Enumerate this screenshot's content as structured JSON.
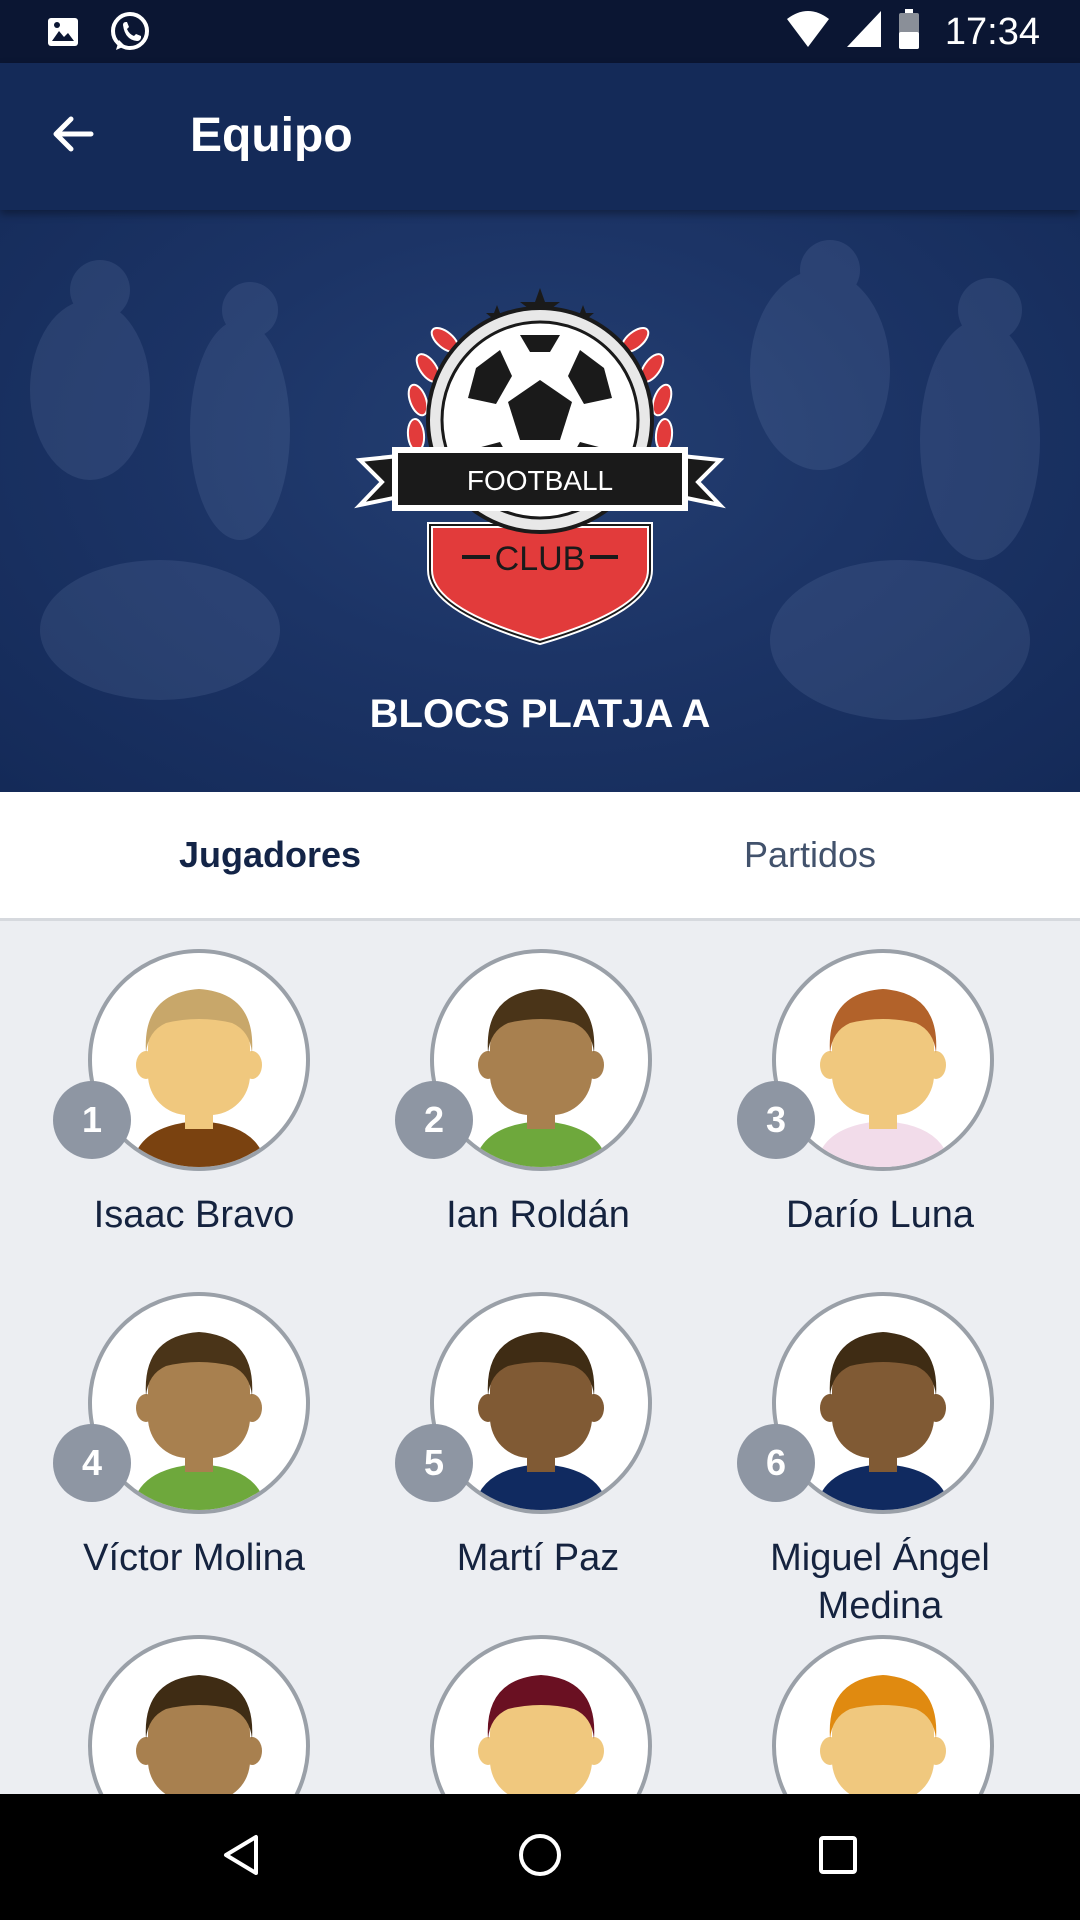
{
  "status_bar": {
    "time": "17:34",
    "left_icons": [
      "image-icon",
      "whatsapp-icon"
    ],
    "right_icons": [
      "wifi-icon",
      "signal-icon",
      "battery-icon"
    ]
  },
  "app_bar": {
    "title": "Equipo",
    "back_icon": "arrow-back-icon"
  },
  "hero": {
    "logo_text_top": "FOOTBALL",
    "logo_text_bottom": "CLUB",
    "team_name": "BLOCS PLATJA A"
  },
  "tabs": [
    {
      "label": "Jugadores",
      "active": true
    },
    {
      "label": "Partidos",
      "active": false
    }
  ],
  "players": [
    {
      "number": "1",
      "name": "Isaac Bravo",
      "hair": "#c8a76a",
      "skin": "#f0c87e",
      "shirt": "#7a4210"
    },
    {
      "number": "2",
      "name": "Ian Roldán",
      "hair": "#4a3418",
      "skin": "#a8804f",
      "shirt": "#6ea83c"
    },
    {
      "number": "3",
      "name": "Darío Luna",
      "hair": "#b2622a",
      "skin": "#f0c87e",
      "shirt": "#f2dcea"
    },
    {
      "number": "4",
      "name": "Víctor Molina",
      "hair": "#4a3418",
      "skin": "#a8804f",
      "shirt": "#6ea83c"
    },
    {
      "number": "5",
      "name": "Martí Paz",
      "hair": "#3f2c14",
      "skin": "#805a34",
      "shirt": "#102a60"
    },
    {
      "number": "6",
      "name": "Miguel Ángel Medina",
      "hair": "#3f2c14",
      "skin": "#805a34",
      "shirt": "#102a60"
    },
    {
      "number": "",
      "name": "",
      "hair": "#3f2c14",
      "skin": "#a8804f",
      "shirt": "#102a60"
    },
    {
      "number": "",
      "name": "",
      "hair": "#6a1022",
      "skin": "#f0c87e",
      "shirt": "#102a60"
    },
    {
      "number": "",
      "name": "",
      "hair": "#e08a10",
      "skin": "#f0c87e",
      "shirt": "#102a60"
    }
  ],
  "nav_bar": {
    "back": "nav-back-icon",
    "home": "nav-home-icon",
    "recents": "nav-recents-icon"
  },
  "colors": {
    "primary": "#142a58",
    "status_bar": "#0b1633",
    "badge": "#8e96a3",
    "active_tab_text": "#132447",
    "logo_red": "#e23b3b"
  }
}
